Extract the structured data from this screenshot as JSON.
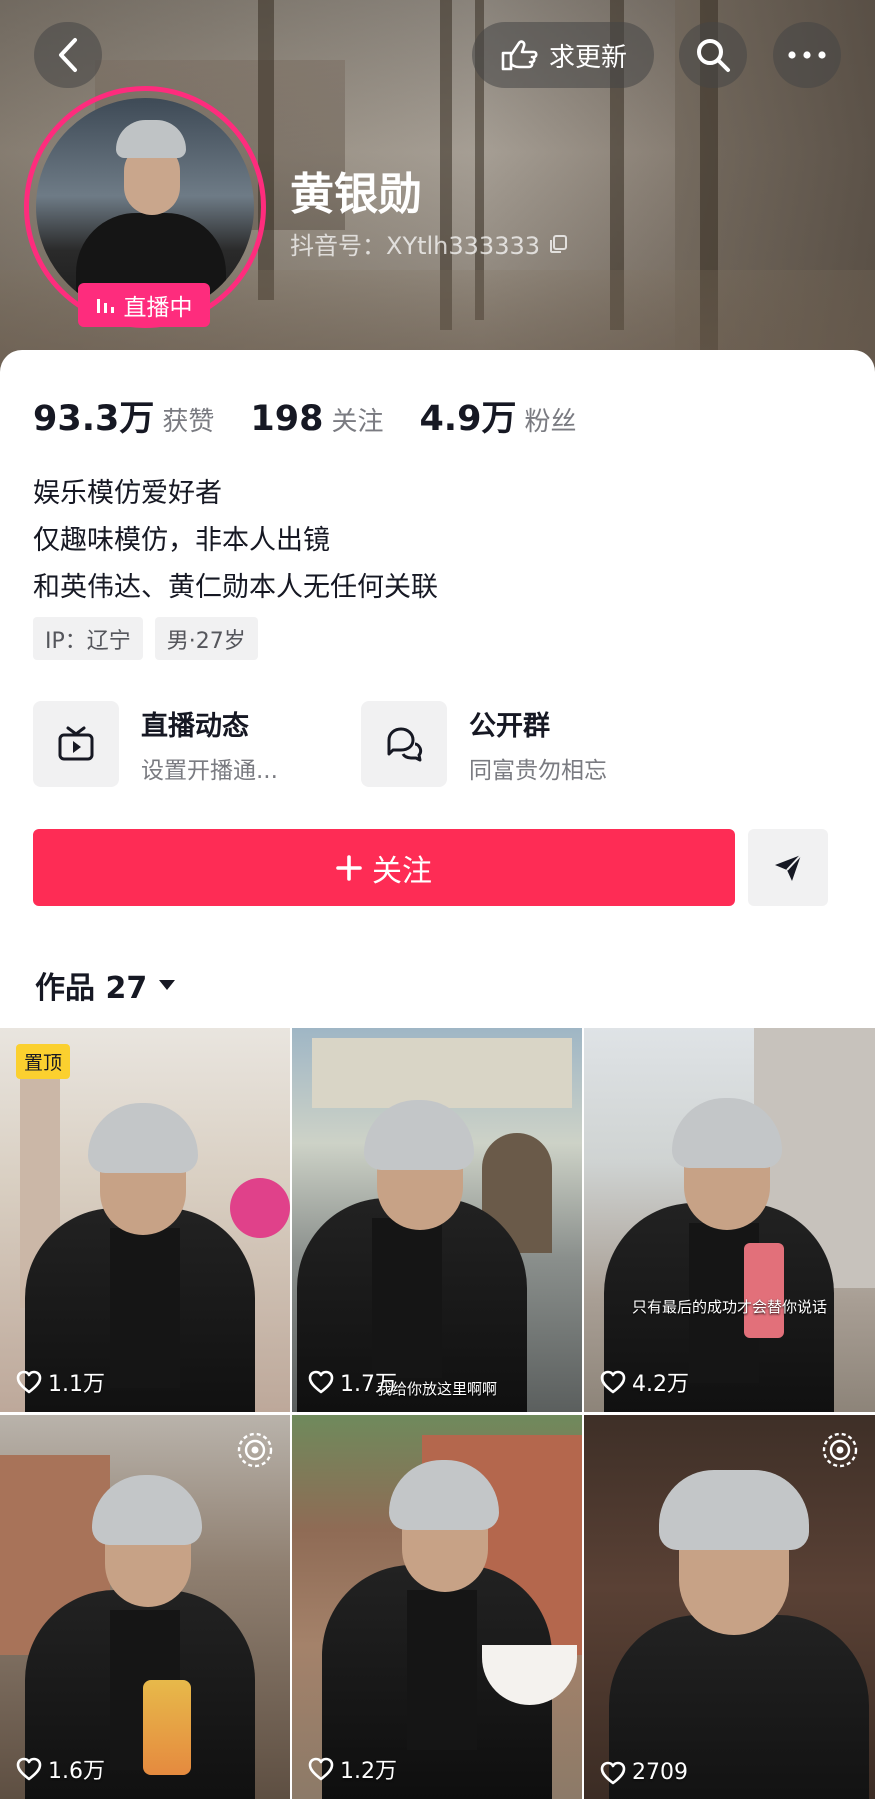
{
  "header": {
    "update_label": "求更新",
    "username": "黄银勋",
    "douyin_id": "抖音号：XYtlh333333",
    "live_label": "直播中"
  },
  "stats": [
    {
      "num": "93.3万",
      "label": "获赞"
    },
    {
      "num": "198",
      "label": "关注"
    },
    {
      "num": "4.9万",
      "label": "粉丝"
    }
  ],
  "bio": {
    "line1": "娱乐模仿爱好者",
    "line2": "仅趣味模仿，非本人出镜",
    "line3": "和英伟达、黄仁勋本人无任何关联"
  },
  "tags": {
    "ip": "IP：辽宁",
    "gender_age": "男·27岁"
  },
  "features": {
    "live": {
      "title": "直播动态",
      "subtitle": "设置开播通..."
    },
    "group": {
      "title": "公开群",
      "subtitle": "同富贵勿相忘"
    }
  },
  "actions": {
    "follow_label": "关注"
  },
  "works": {
    "title": "作品 27"
  },
  "videos": [
    {
      "likes": "1.1万",
      "pinned_label": "置顶"
    },
    {
      "likes": "1.7万",
      "caption": "我给你放这里啊啊"
    },
    {
      "likes": "4.2万",
      "caption": "只有最后的成功才会替你说话"
    },
    {
      "likes": "1.6万"
    },
    {
      "likes": "1.2万"
    },
    {
      "likes": "2709"
    }
  ],
  "colors": {
    "brand_red": "#fe2c55",
    "live_pink": "#fe2c7d",
    "pinned_yellow": "#fbd02f"
  }
}
